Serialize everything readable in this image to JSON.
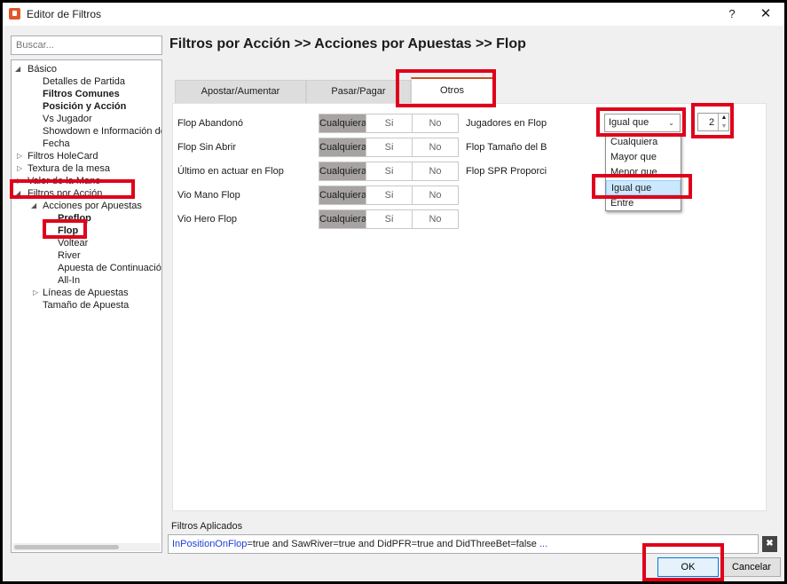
{
  "window": {
    "title": "Editor de Filtros",
    "help_label": "?",
    "close_label": "✕",
    "icon": "app-logo-icon",
    "accent_color": "#e0562a"
  },
  "sidebar": {
    "search_placeholder": "Buscar...",
    "tree": {
      "basico": "Básico",
      "detalles": "Detalles de Partida",
      "filtros_comunes": "Filtros Comunes",
      "posicion_accion": "Posición y Acción",
      "vs_jugador": "Vs Jugador",
      "showdown": "Showdown e Información de",
      "fecha": "Fecha",
      "holecard": "Filtros HoleCard",
      "textura": "Textura de la mesa",
      "valor_mano": "Valor de la Mano",
      "filtros_accion": "Filtros por Acción",
      "acciones_apuestas": "Acciones por Apuestas",
      "preflop": "Preflop",
      "flop": "Flop",
      "voltear": "Voltear",
      "river": "River",
      "apuesta_continuacion": "Apuesta de Continuación",
      "all_in": "All-In",
      "lineas_apuestas": "Líneas de Apuestas",
      "tamano_apuesta": "Tamaño de Apuesta"
    }
  },
  "main": {
    "breadcrumb": "Filtros por Acción >> Acciones por Apuestas >> Flop",
    "tabs": [
      "Apostar/Aumentar",
      "Pasar/Pagar",
      "Otros"
    ],
    "active_tab": "Otros",
    "segment_options": {
      "any": "Cualquiera",
      "yes": "Si",
      "no": "No"
    },
    "filters": [
      {
        "label": "Flop Abandonó",
        "selected": "Cualquiera"
      },
      {
        "label": "Flop Sin Abrir",
        "selected": "Cualquiera"
      },
      {
        "label": "Último en actuar en Flop",
        "selected": "Cualquiera"
      },
      {
        "label": "Vio Mano Flop",
        "selected": "Cualquiera"
      },
      {
        "label": "Vio Hero Flop",
        "selected": "Cualquiera"
      }
    ],
    "right_filters": {
      "jugadores": "Jugadores en Flop",
      "tamano": "Flop Tamaño del B",
      "spr": "Flop SPR Proporci"
    },
    "comparison": {
      "value": "Igual que",
      "options": [
        "Cualquiera",
        "Mayor que",
        "Menor que",
        "Igual que",
        "Entre"
      ],
      "highlighted": "Igual que"
    },
    "stepper_value": "2"
  },
  "applied": {
    "label": "Filtros Aplicados",
    "link_text": "InPositionOnFlop",
    "rest_text": "=true and SawRiver=true and DidPFR=true and DidThreeBet=false",
    "more": " ...",
    "clear_label": "✖"
  },
  "buttons": {
    "ok": "OK",
    "cancel": "Cancelar"
  },
  "colors": {
    "highlight": "#e0001b",
    "link": "#1b3fd8",
    "segment_selected": "#a8a3a3",
    "tab_accent": "#c8511b"
  }
}
